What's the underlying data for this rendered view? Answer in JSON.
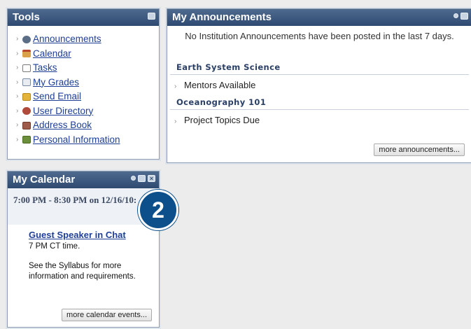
{
  "tools": {
    "title": "Tools",
    "items": [
      {
        "label": "Announcements",
        "icon": "announcements-icon",
        "color": "#5b6e86"
      },
      {
        "label": "Calendar",
        "icon": "calendar-icon",
        "color": "#d9a24a"
      },
      {
        "label": "Tasks",
        "icon": "tasks-icon",
        "color": "#9a9a9a"
      },
      {
        "label": "My Grades",
        "icon": "grades-icon",
        "color": "#7a8aa0"
      },
      {
        "label": "Send Email",
        "icon": "email-icon",
        "color": "#e4b43a"
      },
      {
        "label": "User Directory",
        "icon": "user-directory-icon",
        "color": "#b04a3a"
      },
      {
        "label": "Address Book",
        "icon": "address-book-icon",
        "color": "#a05a4a"
      },
      {
        "label": "Personal Information",
        "icon": "personal-information-icon",
        "color": "#6b8f3a"
      }
    ]
  },
  "announcements": {
    "title": "My Announcements",
    "message": "No Institution Announcements have been posted in the last 7 days.",
    "courses": [
      {
        "name": "Earth System Science",
        "item": "Mentors Available"
      },
      {
        "name": "Oceanography 101",
        "item": "Project Topics Due"
      }
    ],
    "more": "more announcements..."
  },
  "calendar": {
    "title": "My Calendar",
    "time": "7:00 PM - 8:30 PM on 12/16/10:",
    "event_title": "Guest Speaker in Chat",
    "event_line1": "7 PM CT time.",
    "event_line2": "See the Syllabus for more information and requirements.",
    "more": "more calendar events..."
  },
  "callout": "2",
  "colors": {
    "header": "#2f4a70",
    "link": "#1f3f97",
    "badge": "#0d4f8b"
  }
}
